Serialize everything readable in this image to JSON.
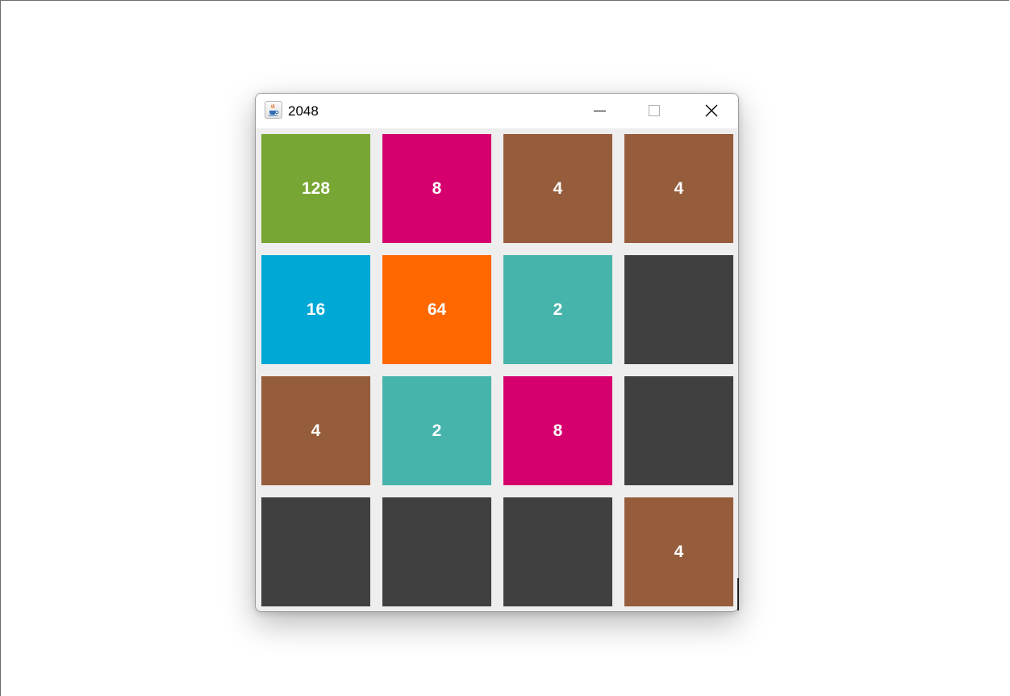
{
  "window": {
    "title": "2048",
    "icon": "java-coffee-cup-icon",
    "controls": {
      "minimize": "minimize-icon",
      "maximize": "maximize-icon",
      "close": "close-icon"
    }
  },
  "colors": {
    "board_background": "#eeeeee",
    "empty": "#404040",
    "tile_2": "#46b4aa",
    "tile_4": "#965d3c",
    "tile_8": "#d5006d",
    "tile_16": "#00a8d6",
    "tile_64": "#ff6700",
    "tile_128": "#78a634",
    "tile_text": "#ffffff"
  },
  "board": {
    "rows": [
      [
        "128",
        "8",
        "4",
        "4"
      ],
      [
        "16",
        "64",
        "2",
        ""
      ],
      [
        "4",
        "2",
        "8",
        ""
      ],
      [
        "",
        "",
        "",
        "4"
      ]
    ]
  }
}
